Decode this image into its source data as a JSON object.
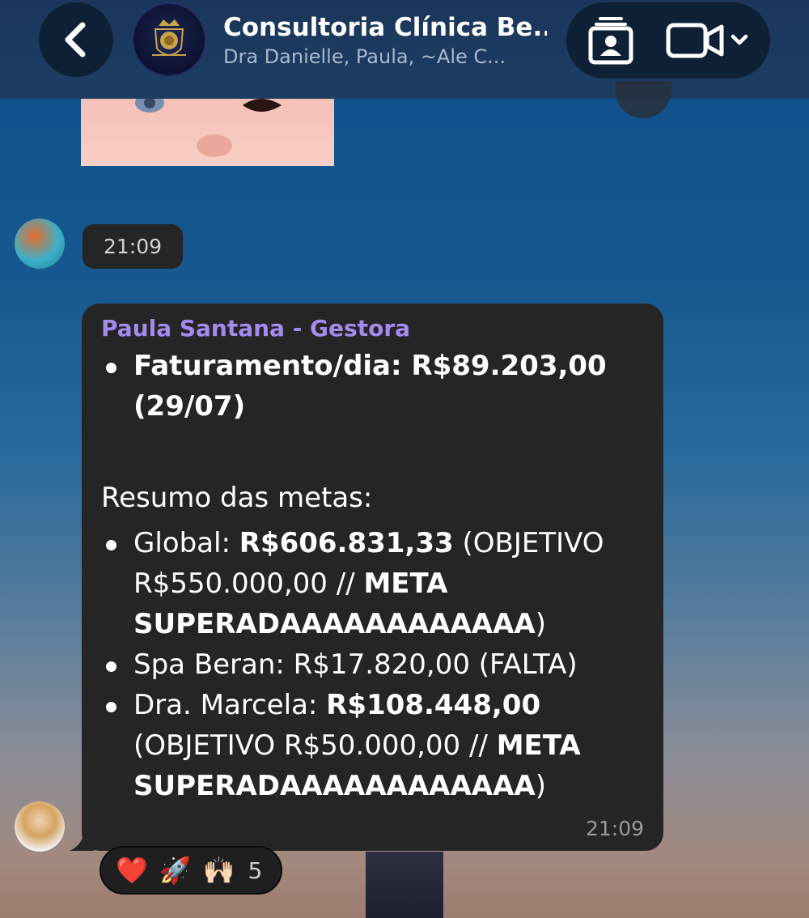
{
  "header": {
    "title": "Consultoria Clínica Be...",
    "subtitle": "Dra Danielle, Paula, ~Ale C...",
    "back_icon": "chevron-left-icon",
    "contact_icon": "contact-card-icon",
    "video_icon": "video-camera-icon"
  },
  "messages": {
    "time_chip": "21:09",
    "bubble": {
      "sender": "Paula Santana - Gestora",
      "line1_label": "Faturamento/dia: R$89.203,00",
      "line1_cont": "(29/07)",
      "heading": "Resumo das metas:",
      "global_label": "Global: ",
      "global_value": "R$606.831,33",
      "global_rest": " (OBJETIVO",
      "global_line2_a": "R$550.000,00 // ",
      "global_line2_b": "META",
      "global_line3": "SUPERADAAAAAAAAAAAA",
      "global_line3_end": ")",
      "spa": "Spa Beran: R$17.820,00 (FALTA)",
      "marcela_label": "Dra. Marcela: ",
      "marcela_value": "R$108.448,00",
      "marcela_line2_a": "(OBJETIVO R$50.000,00 // ",
      "marcela_line2_b": "META",
      "marcela_line3": "SUPERADAAAAAAAAAAAA",
      "marcela_line3_end": ")",
      "time": "21:09"
    },
    "reactions": {
      "emojis": [
        "❤️",
        "🚀",
        "🙌🏻"
      ],
      "count": "5"
    }
  },
  "colors": {
    "sender": "#a38cf0",
    "bubble": "#252525"
  }
}
